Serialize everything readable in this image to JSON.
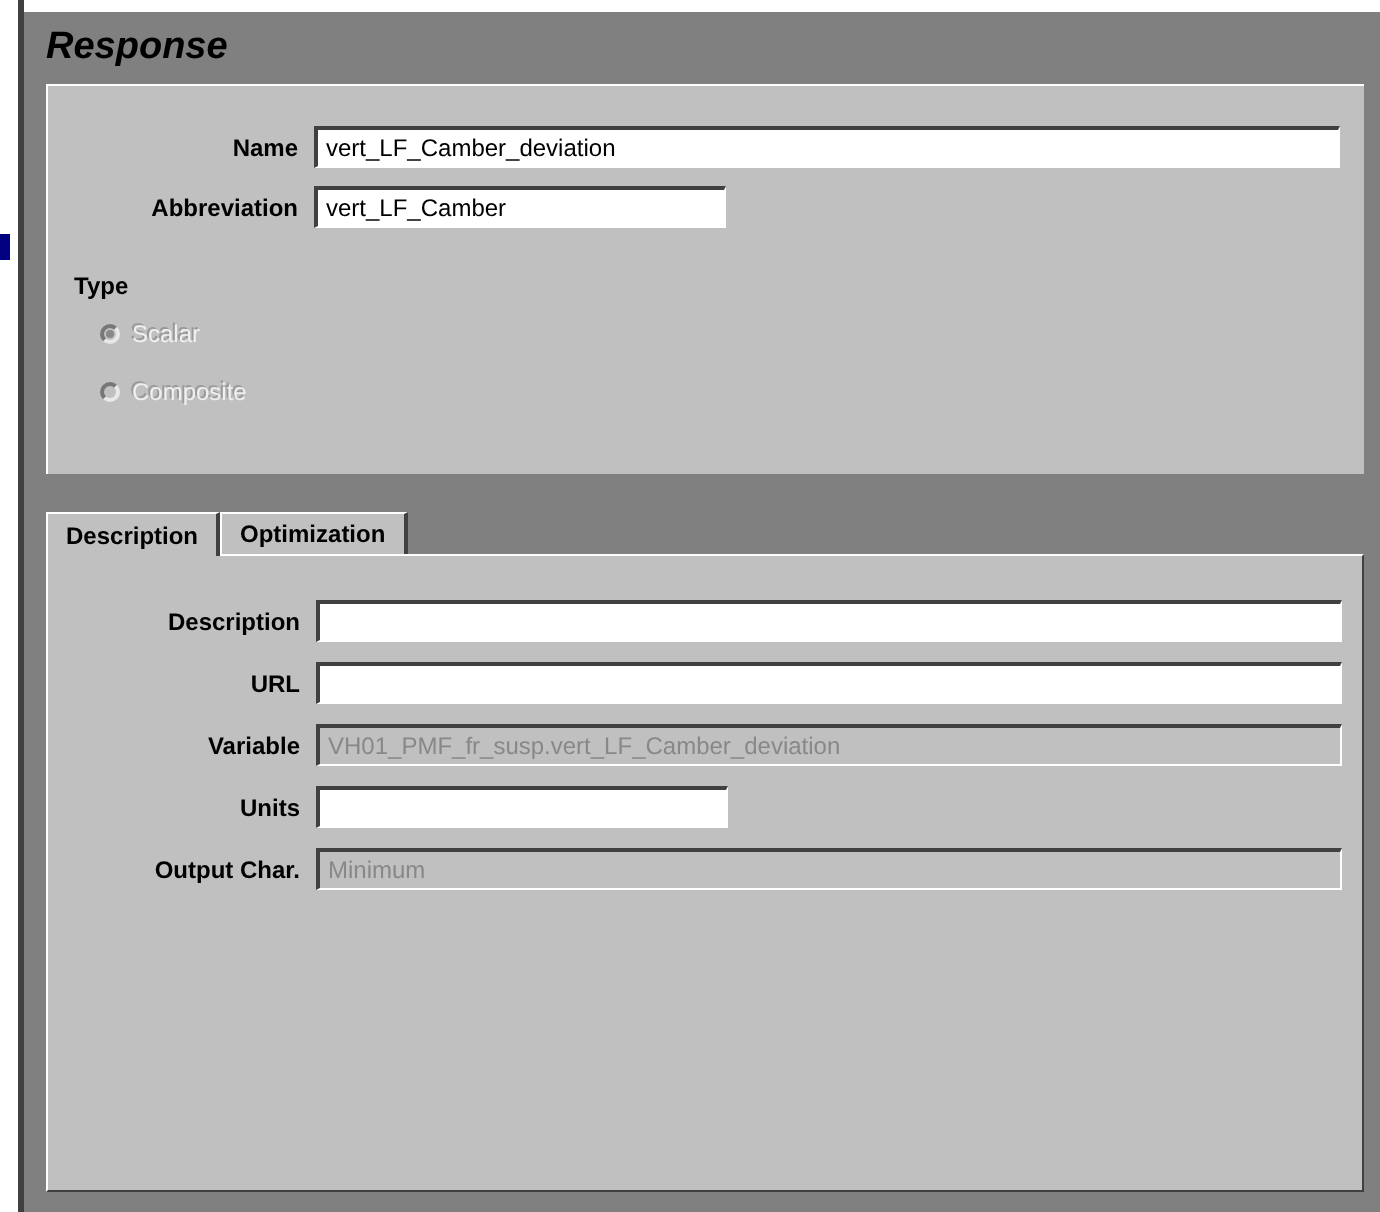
{
  "title": "Response",
  "fields": [
    {
      "label": "Name",
      "value": "vert_LF_Camber_deviation",
      "kind": "wide",
      "disabled": false
    },
    {
      "label": "Abbreviation",
      "value": "vert_LF_Camber",
      "kind": "short",
      "disabled": false
    }
  ],
  "type": {
    "label": "Type",
    "options": [
      {
        "label": "Scalar",
        "selected": true,
        "disabled": true
      },
      {
        "label": "Composite",
        "selected": false,
        "disabled": true
      }
    ]
  },
  "tabs": [
    {
      "label": "Description",
      "selected": true
    },
    {
      "label": "Optimization",
      "selected": false
    }
  ],
  "tab_fields": [
    {
      "label": "Description",
      "kind": "wide",
      "disabled": false
    },
    {
      "label": "URL",
      "kind": "wide",
      "disabled": false
    },
    {
      "label": "Variable",
      "value": "VH01_PMF_fr_susp.vert_LF_Camber_deviation",
      "kind": "wide",
      "disabled": true
    },
    {
      "label": "Units",
      "kind": "short",
      "disabled": false
    },
    {
      "label": "Output Char.",
      "value": "Minimum",
      "kind": "wide",
      "disabled": true
    }
  ]
}
